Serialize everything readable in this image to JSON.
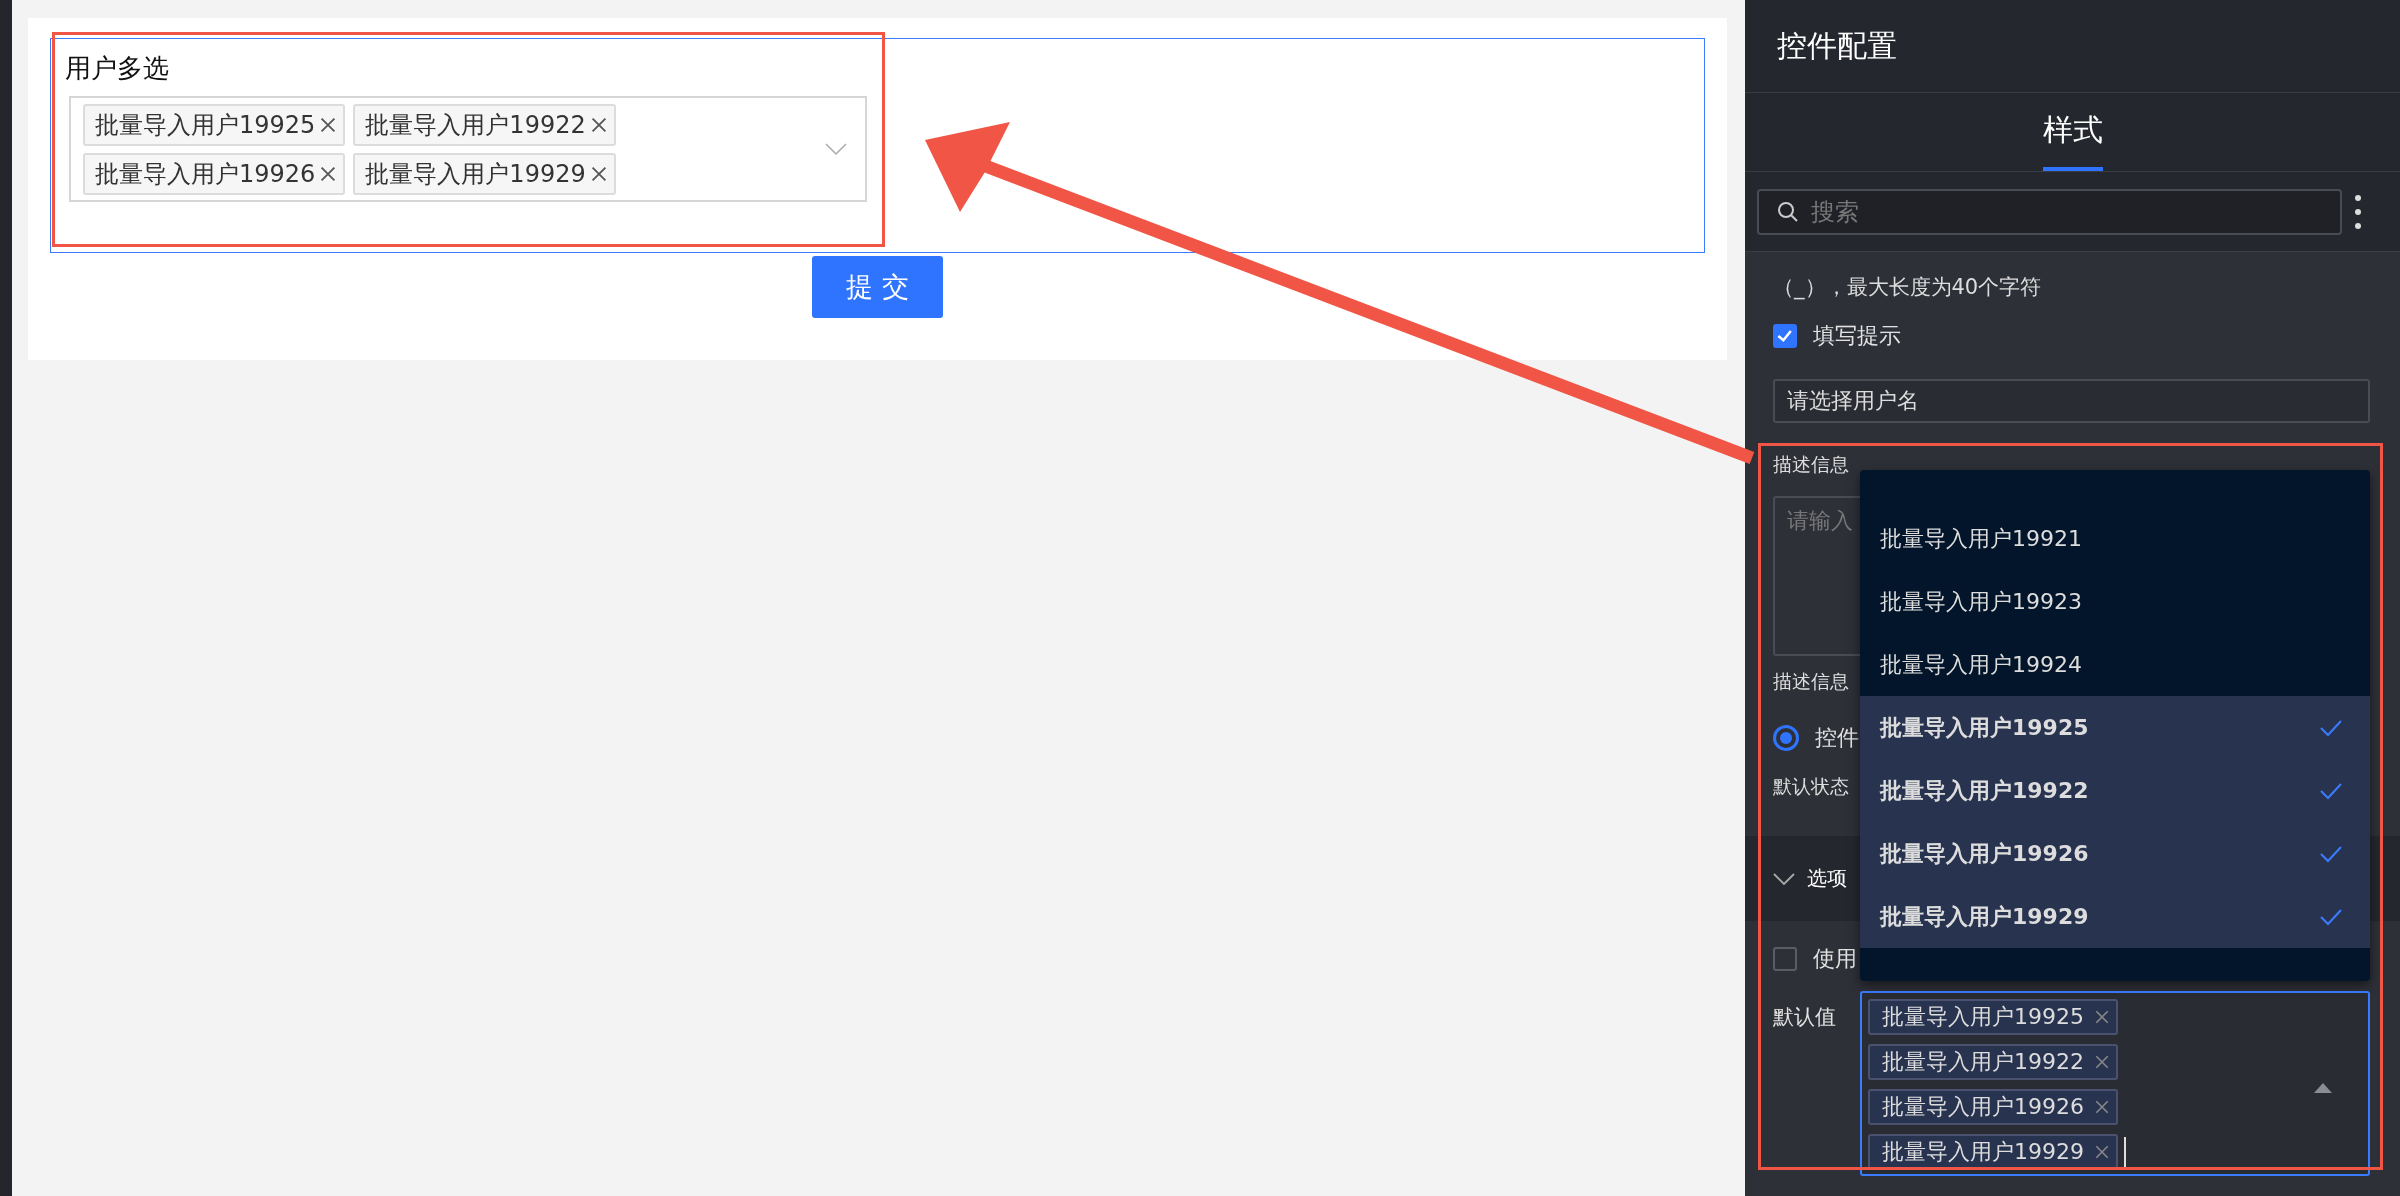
{
  "canvas": {
    "form_label": "用户多选",
    "tags": [
      {
        "label": "批量导入用户19925"
      },
      {
        "label": "批量导入用户19922"
      },
      {
        "label": "批量导入用户19926"
      },
      {
        "label": "批量导入用户19929"
      }
    ],
    "submit": "提 交"
  },
  "panel": {
    "title": "控件配置",
    "tabs": [
      {
        "label": "样式",
        "selected": true
      }
    ],
    "search": {
      "placeholder": "搜索"
    },
    "help_text": [
      "（_），最大长度为40个字符"
    ],
    "hint_checkbox": {
      "label": "填写提示",
      "checked": true
    },
    "hint_input": {
      "value": "请选择用户名"
    },
    "description_label": "描述信息",
    "description_input": {
      "placeholder": "请输入"
    },
    "description_position_label": "描述信息",
    "position_radio": {
      "label": "控件",
      "selected": true
    },
    "default_state_label": "默认状态",
    "options_section": {
      "title": "选项",
      "expanded": true
    },
    "use_checkbox": {
      "label": "使用",
      "checked": false
    },
    "default_value_label": "默认值",
    "default_value_tags": [
      {
        "label": "批量导入用户19925"
      },
      {
        "label": "批量导入用户19922"
      },
      {
        "label": "批量导入用户19926"
      },
      {
        "label": "批量导入用户19929"
      }
    ],
    "dropdown": [
      {
        "label": "批量导入用户19921",
        "selected": false
      },
      {
        "label": "批量导入用户19923",
        "selected": false
      },
      {
        "label": "批量导入用户19924",
        "selected": false
      },
      {
        "label": "批量导入用户19925",
        "selected": true
      },
      {
        "label": "批量导入用户19922",
        "selected": true
      },
      {
        "label": "批量导入用户19926",
        "selected": true
      },
      {
        "label": "批量导入用户19929",
        "selected": true
      }
    ]
  }
}
